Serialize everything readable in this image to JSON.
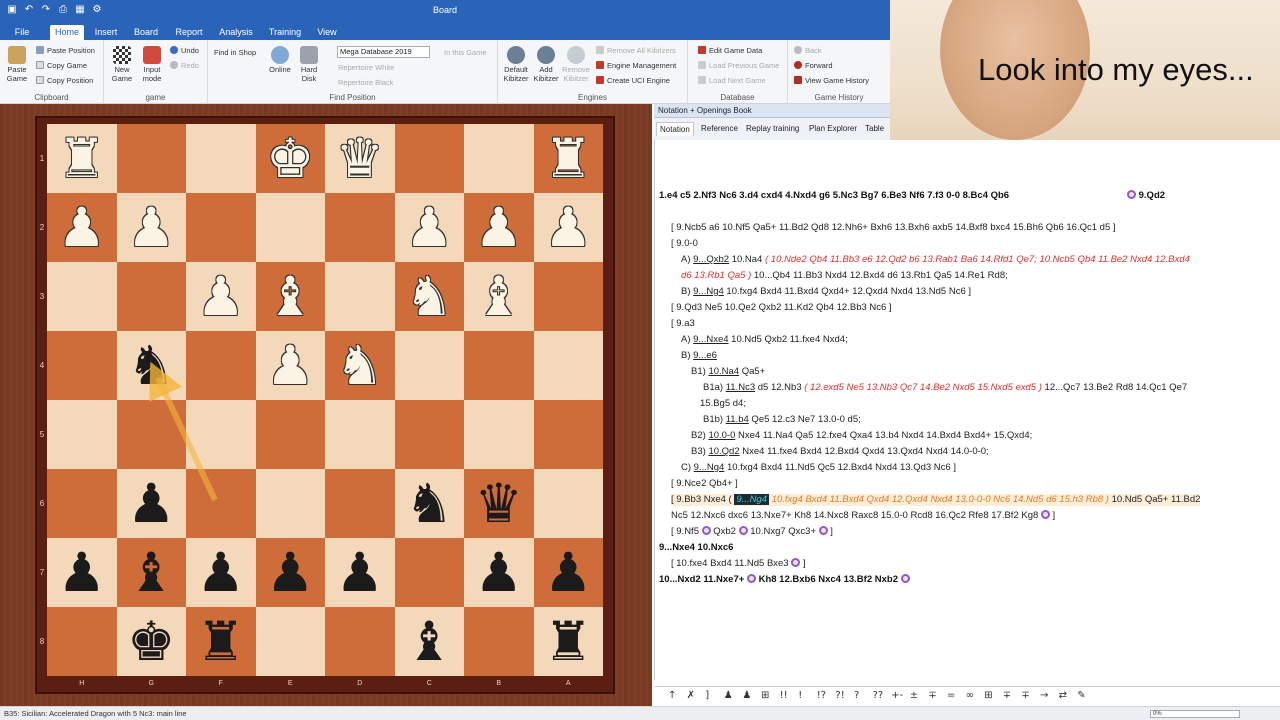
{
  "window": {
    "title": "Board"
  },
  "ribbon": {
    "tabs": [
      "File",
      "Home",
      "Insert",
      "Board",
      "Report",
      "Analysis",
      "Training",
      "View"
    ],
    "active_tab": "Home",
    "clipboard": {
      "label": "Clipboard",
      "paste_game": "Paste Game",
      "paste_position": "Paste Position",
      "copy_game": "Copy Game",
      "copy_position": "Copy Position"
    },
    "game": {
      "label": "game",
      "new_game": "New Game",
      "input_mode": "Input mode",
      "undo": "Undo",
      "redo": "Redo"
    },
    "find_position": {
      "label": "Find Position",
      "find_in_shop": "Find in Shop",
      "online": "Online",
      "hard_disk": "Hard Disk",
      "database_value": "Mega Database 2019",
      "in_this_game": "In this Game",
      "repertoire_white": "Repertoire White",
      "repertoire_black": "Repertoire Black"
    },
    "engines": {
      "label": "Engines",
      "default_kibitzer": "Default Kibitzer",
      "add_kibitzer": "Add Kibitzer",
      "remove_kibitzer": "Remove Kibitzer",
      "remove_all_kibitzers": "Remove All Kibitzers",
      "engine_management": "Engine Management",
      "create_uci_engine": "Create UCI Engine"
    },
    "database": {
      "label": "Database",
      "edit_game_data": "Edit Game Data",
      "load_previous_game": "Load Previous Game",
      "load_next_game": "Load Next Game"
    },
    "game_history": {
      "label": "Game History",
      "back": "Back",
      "forward": "Forward",
      "view_game_history": "View Game History"
    }
  },
  "webcam": {
    "caption": "Look into my eyes..."
  },
  "board": {
    "rank_labels": [
      "1",
      "2",
      "3",
      "4",
      "5",
      "6",
      "7",
      "8"
    ],
    "file_labels": [
      "H",
      "G",
      "F",
      "E",
      "D",
      "C",
      "B",
      "A"
    ],
    "rows": [
      [
        "wR",
        "",
        "",
        "wK",
        "wQ",
        "",
        "",
        "wR"
      ],
      [
        "wP",
        "wP",
        "",
        "",
        "",
        "wP",
        "wP",
        "wP"
      ],
      [
        "",
        "",
        "wP",
        "wB",
        "",
        "wN",
        "wB",
        ""
      ],
      [
        "",
        "bN",
        "",
        "wP",
        "wN",
        "",
        "",
        ""
      ],
      [
        "",
        "",
        "",
        "",
        "",
        "",
        "",
        ""
      ],
      [
        "",
        "bP",
        "",
        "",
        "",
        "bN",
        "bQ",
        ""
      ],
      [
        "bP",
        "bB",
        "bP",
        "bP",
        "bP",
        "",
        "bP",
        "bP"
      ],
      [
        "",
        "bK",
        "bR",
        "",
        "",
        "bB",
        "",
        "bR"
      ]
    ]
  },
  "notation": {
    "panel_title": "Notation + Openings Book",
    "tabs": [
      "Notation",
      "Reference",
      "Replay training",
      "Plan Explorer",
      "Table"
    ],
    "active_tab": "Notation",
    "lines": [
      {
        "kind": "main",
        "text": "1.e4  c5  2.Nf3  Nc6  3.d4  cxd4  4.Nxd4  g6  5.Nc3  Bg7  6.Be3  Nf6  7.f3  0-0  8.Bc4  Qb6"
      },
      {
        "kind": "main_tail",
        "text": "9.Qd2"
      },
      {
        "kind": "plain",
        "text": "[ 9.Ncb5  a6  10.Nf5  Qa5+  11.Bd2  Qd8  12.Nh6+  Bxh6  13.Bxh6  axb5  14.Bxf8  bxc4  15.Bh6  Qb6  16.Qc1  d5 ]"
      },
      {
        "kind": "plain",
        "text": "[ 9.0-0"
      },
      {
        "kind": "var_a",
        "label": "A)",
        "move": "9...Qxb2",
        "text": "10.Na4",
        "red": "( 10.Nde2  Qb4  11.Bb3  e6  12.Qd2  b6  13.Rab1  Ba6  14.Rfd1  Qe7; 10.Ncb5  Qb4  11.Be2  Nxd4  12.Bxd4"
      },
      {
        "kind": "red_cont",
        "red": "d6  13.Rb1  Qa5 )",
        "text": "10...Qb4  11.Bb3  Nxd4  12.Bxd4  d6  13.Rb1  Qa5  14.Re1  Rd8;"
      },
      {
        "kind": "var_b",
        "label": "B)",
        "move": "9...Ng4",
        "text": "10.fxg4  Bxd4  11.Bxd4  Qxd4+  12.Qxd4  Nxd4  13.Nd5  Nc6 ]"
      },
      {
        "kind": "plain",
        "text": "[ 9.Qd3  Ne5  10.Qe2  Qxb2  11.Kd2  Qb4  12.Bb3  Nc6 ]"
      },
      {
        "kind": "plain",
        "text": "[ 9.a3"
      },
      {
        "kind": "var_a",
        "label": "A)",
        "move": "9...Nxe4",
        "text": "10.Nd5  Qxb2  11.fxe4  Nxd4;"
      },
      {
        "kind": "var_b",
        "label": "B)",
        "move": "9...e6",
        "text": ""
      },
      {
        "kind": "var_b1",
        "label": "B1)",
        "move": "10.Na4",
        "text": "Qa5+"
      },
      {
        "kind": "var_b1a",
        "label": "B1a)",
        "move": "11.Nc3",
        "text": "d5  12.Nb3",
        "red": "( 12.exd5  Ne5  13.Nb3  Qc7  14.Be2  Nxd5  15.Nxd5  exd5 )",
        "text2": "12...Qc7  13.Be2  Rd8  14.Qc1  Qe7"
      },
      {
        "kind": "plain_indent",
        "text": "15.Bg5  d4;"
      },
      {
        "kind": "var_b1b",
        "label": "B1b)",
        "move": "11.b4",
        "text": "Qe5  12.c3  Ne7  13.0-0  d5;"
      },
      {
        "kind": "var_b2",
        "label": "B2)",
        "move": "10.0-0",
        "text": "Nxe4  11.Na4  Qa5  12.fxe4  Qxa4  13.b4  Nxd4  14.Bxd4  Bxd4+  15.Qxd4;"
      },
      {
        "kind": "var_b3",
        "label": "B3)",
        "move": "10.Qd2",
        "text": "Nxe4  11.fxe4  Bxd4  12.Bxd4  Qxd4  13.Qxd4  Nxd4  14.0-0-0;"
      },
      {
        "kind": "var_c",
        "label": "C)",
        "move": "9...Ng4",
        "text": "10.fxg4  Bxd4  11.Nd5  Qc5  12.Bxd4  Nxd4  13.Qd3  Nc6 ]"
      },
      {
        "kind": "plain",
        "text": "[ 9.Nce2  Qb4+ ]"
      },
      {
        "kind": "highlight",
        "text": "[ 9.Bb3  Nxe4  (",
        "hl": "9...Ng4",
        "orange": "10.fxg4  Bxd4  11.Bxd4  Qxd4  12.Qxd4  Nxd4  13.0-0-0  Nc6  14.Nd5  d6  15.h3  Rb8 )",
        "tail": "10.Nd5  Qa5+  11.Bd2"
      },
      {
        "kind": "plain",
        "text": "Nc5  12.Nxc6  dxc6  13.Nxe7+  Kh8  14.Nxc8  Raxc8  15.0-0  Rcd8  16.Qc2  Rfe8  17.Bf2  Kg8"
      },
      {
        "kind": "medal_line",
        "text1": "[ 9.Nf5",
        "text2": "Qxb2",
        "text3": "10.Nxg7  Qxc3+",
        "text4": "]"
      },
      {
        "kind": "main",
        "text": "9...Nxe4  10.Nxc6"
      },
      {
        "kind": "plain",
        "text": "[ 10.fxe4  Bxd4  11.Nd5  Bxe3"
      },
      {
        "kind": "main_last",
        "text": "10...Nxd2  11.Nxe7+",
        "text2": "Kh8  12.Bxb6  Nxc4  13.Bf2  Nxb2"
      }
    ]
  },
  "toolbar_symbols": [
    "↑",
    "✗",
    "]",
    "♟",
    "♟",
    "⊞",
    "!!",
    "!",
    "!?",
    "?!",
    "?",
    "??",
    "+-",
    "±",
    "∓",
    "=",
    "∞",
    "⊞",
    "∓",
    "∓",
    "→",
    "⇄",
    "✎"
  ],
  "statusbar": {
    "text": "B35: Sicilian: Accelerated Dragon with 5 Nc3: main line",
    "progress": "0%"
  },
  "colors": {
    "ribbon_blue": "#2a64b8",
    "light_square": "#f3d9b9",
    "dark_square": "#cf6d3a",
    "variation_red": "#e0302a",
    "highlight_cyan": "#28d6d0"
  }
}
